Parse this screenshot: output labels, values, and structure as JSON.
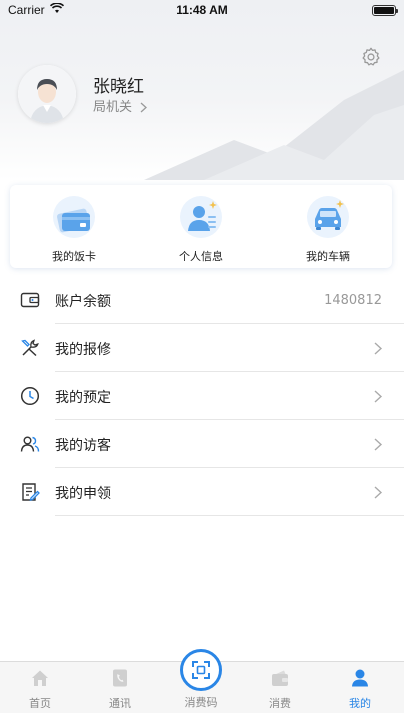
{
  "status_bar": {
    "carrier": "Carrier",
    "time": "11:48 AM"
  },
  "profile": {
    "name": "张晓红",
    "department": "局机关"
  },
  "quick_actions": [
    {
      "label": "我的饭卡",
      "icon": "meal-card-icon"
    },
    {
      "label": "个人信息",
      "icon": "personal-info-icon"
    },
    {
      "label": "我的车辆",
      "icon": "car-icon"
    }
  ],
  "menu": [
    {
      "label": "账户余额",
      "value": "1480812",
      "icon": "wallet-icon"
    },
    {
      "label": "我的报修",
      "icon": "repair-tools-icon"
    },
    {
      "label": "我的预定",
      "icon": "clock-icon"
    },
    {
      "label": "我的访客",
      "icon": "visitors-icon"
    },
    {
      "label": "我的申领",
      "icon": "application-form-icon"
    }
  ],
  "tabs": [
    {
      "label": "首页",
      "icon": "home-icon"
    },
    {
      "label": "通讯",
      "icon": "phone-book-icon"
    },
    {
      "label": "消费码",
      "icon": "scan-code-icon"
    },
    {
      "label": "消费",
      "icon": "wallet-icon"
    },
    {
      "label": "我的",
      "icon": "user-icon",
      "active": true
    }
  ],
  "colors": {
    "accent": "#2a86e6",
    "icon_blue": "#5aa3ea"
  }
}
